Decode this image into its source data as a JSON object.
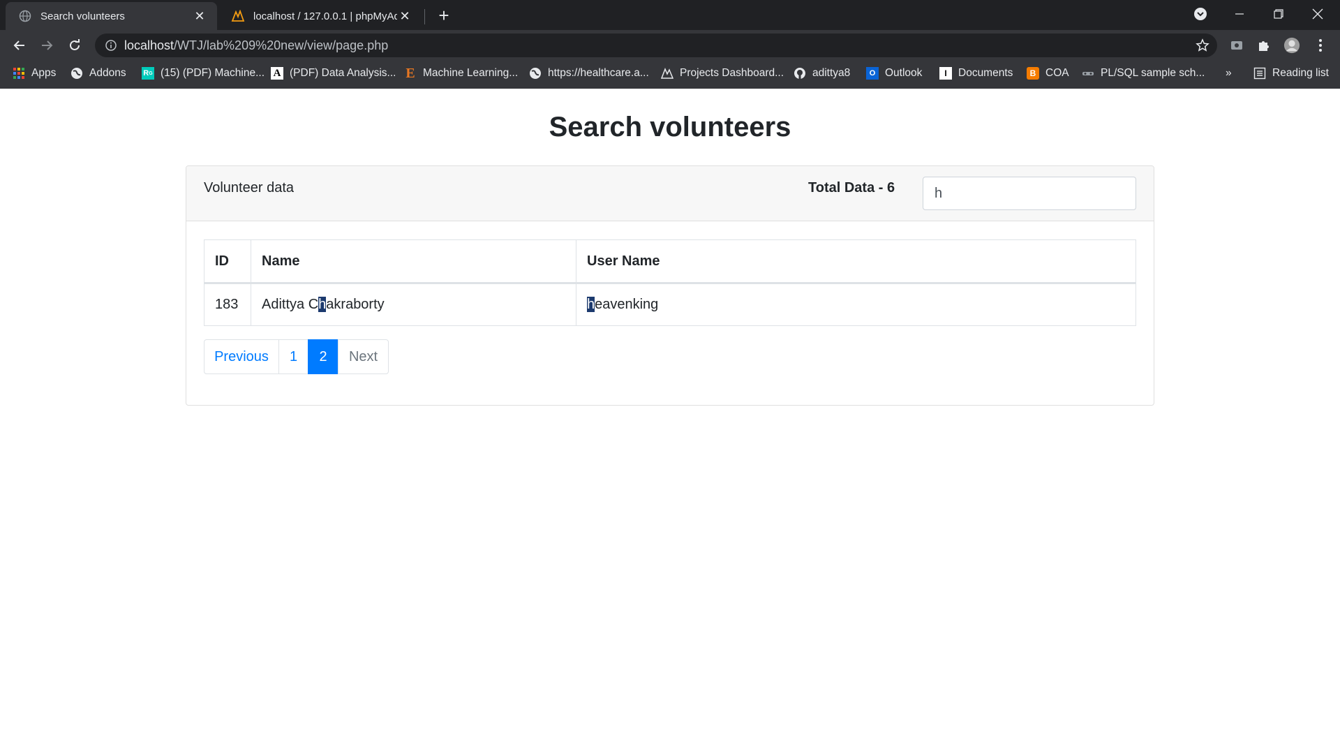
{
  "browser": {
    "tabs": [
      {
        "title": "Search volunteers",
        "active": true
      },
      {
        "title": "localhost / 127.0.0.1 | phpMyAdmin",
        "active": false
      }
    ],
    "url_host": "localhost",
    "url_path": "/WTJ/lab%209%20new/view/page.php",
    "bookmarks": [
      {
        "label": "Apps",
        "icon": "apps-grid-icon"
      },
      {
        "label": "Addons",
        "icon": "globe-icon"
      },
      {
        "label": "(15) (PDF) Machine...",
        "icon": "researchgate-icon"
      },
      {
        "label": "(PDF) Data Analysis...",
        "icon": "academia-icon"
      },
      {
        "label": "Machine Learning...",
        "icon": "e-icon"
      },
      {
        "label": "https://healthcare.a...",
        "icon": "globe-icon"
      },
      {
        "label": "Projects Dashboard...",
        "icon": "dashboard-icon"
      },
      {
        "label": "adittya8",
        "icon": "github-icon"
      },
      {
        "label": "Outlook",
        "icon": "outlook-icon"
      },
      {
        "label": "Documents",
        "icon": "documents-icon"
      },
      {
        "label": "COA",
        "icon": "blogger-icon"
      },
      {
        "label": "PL/SQL sample sch...",
        "icon": "database-icon"
      }
    ],
    "more_bookmarks": "»",
    "reading_list": "Reading list"
  },
  "page": {
    "title": "Search volunteers",
    "card_title": "Volunteer data",
    "total_label": "Total Data - 6",
    "search_value": "h",
    "table": {
      "headers": [
        "ID",
        "Name",
        "User Name"
      ],
      "rows": [
        {
          "id": "183",
          "name_before": "Adittya C",
          "name_hl": "h",
          "name_after": "akraborty",
          "user_hl": "h",
          "user_after": "eavenking"
        }
      ]
    },
    "pagination": {
      "previous": "Previous",
      "pages": [
        "1",
        "2"
      ],
      "active_page": "2",
      "next": "Next"
    }
  },
  "colors": {
    "primary": "#007bff",
    "highlight": "#1c3a6e",
    "chrome_dark": "#202124",
    "chrome_toolbar": "#35363a"
  }
}
